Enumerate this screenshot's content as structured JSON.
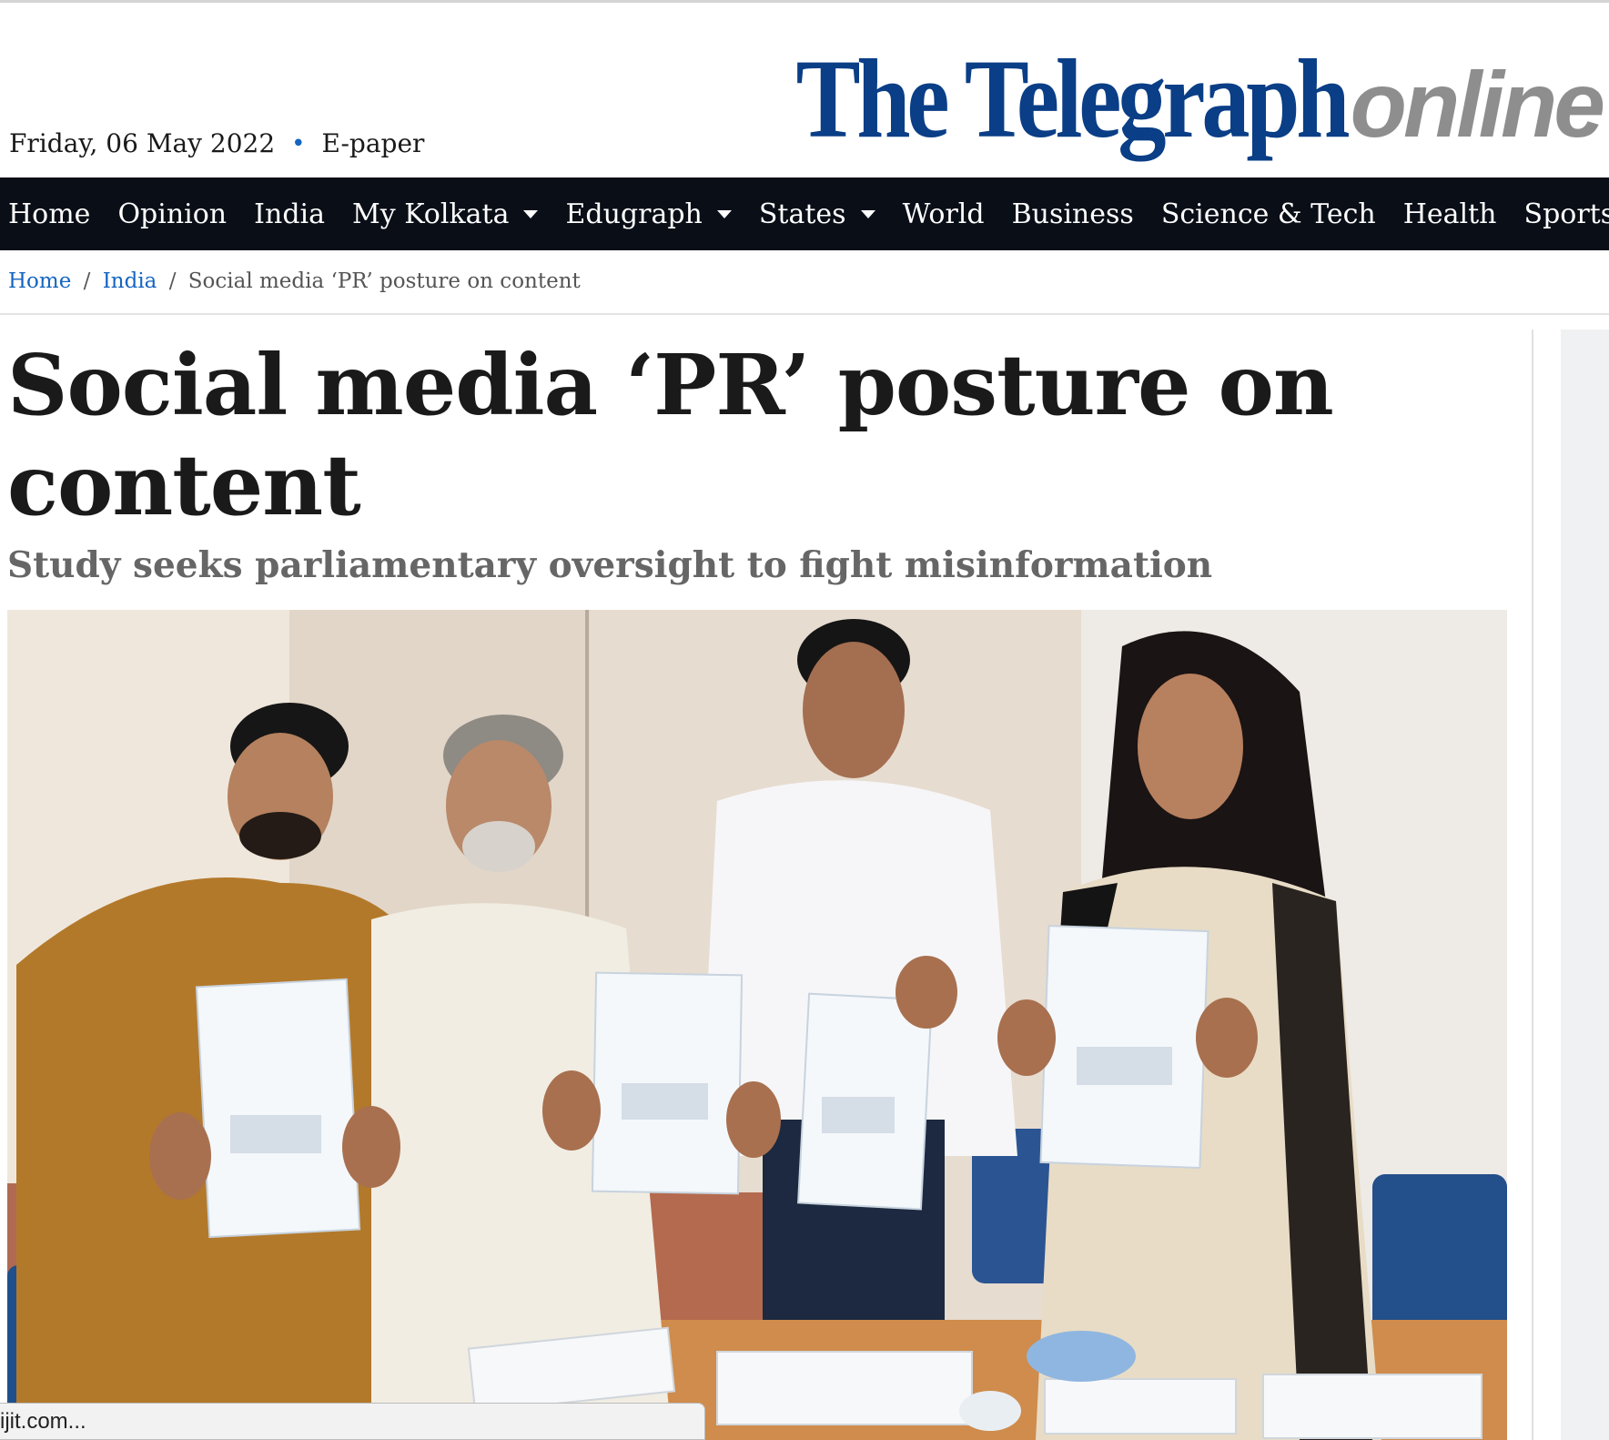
{
  "header": {
    "date": "Friday, 06 May 2022",
    "separator": "•",
    "epaper": "E-paper",
    "logo_main": "The Telegraph",
    "logo_online": "online"
  },
  "nav": {
    "items": [
      {
        "label": "Home",
        "dropdown": false
      },
      {
        "label": "Opinion",
        "dropdown": false
      },
      {
        "label": "India",
        "dropdown": false
      },
      {
        "label": "My Kolkata",
        "dropdown": true
      },
      {
        "label": "Edugraph",
        "dropdown": true
      },
      {
        "label": "States",
        "dropdown": true
      },
      {
        "label": "World",
        "dropdown": false
      },
      {
        "label": "Business",
        "dropdown": false
      },
      {
        "label": "Science & Tech",
        "dropdown": false
      },
      {
        "label": "Health",
        "dropdown": false
      },
      {
        "label": "Sports",
        "dropdown": true
      }
    ]
  },
  "breadcrumb": {
    "home": "Home",
    "section": "India",
    "separator": "/",
    "current": "Social media ‘PR’ posture on content"
  },
  "article": {
    "headline": "Social media ‘PR’ posture on content",
    "subhead": "Study seeks parliamentary oversight to fight misinformation"
  },
  "status_bar": {
    "url": "ijit.com..."
  },
  "colors": {
    "brand_blue": "#0a3e86",
    "nav_bg": "#0a0e17",
    "link_blue": "#1565c0",
    "logo_grey": "#8e8e8e"
  }
}
